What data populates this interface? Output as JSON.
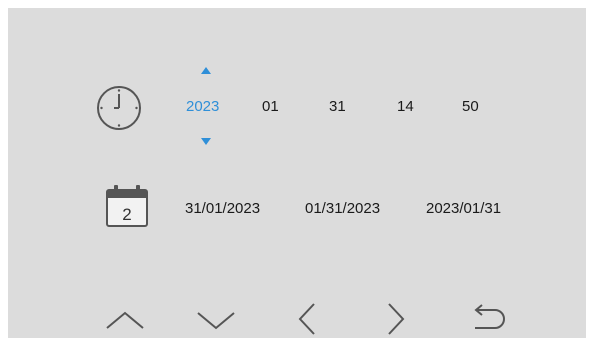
{
  "datetime": {
    "year": "2023",
    "month": "01",
    "day": "31",
    "hour": "14",
    "minute": "50",
    "selected_field": "year"
  },
  "date_formats": [
    "31/01/2023",
    "01/31/2023",
    "2023/01/31"
  ],
  "calendar_icon": {
    "day_number": "2"
  },
  "nav": {
    "icons": [
      "chevron-up-icon",
      "chevron-down-icon",
      "chevron-left-icon",
      "chevron-right-icon",
      "back-icon"
    ]
  },
  "colors": {
    "background": "#dcdcdc",
    "accent": "#2f8fd8",
    "text": "#1a1a1a",
    "icon": "#555555"
  }
}
